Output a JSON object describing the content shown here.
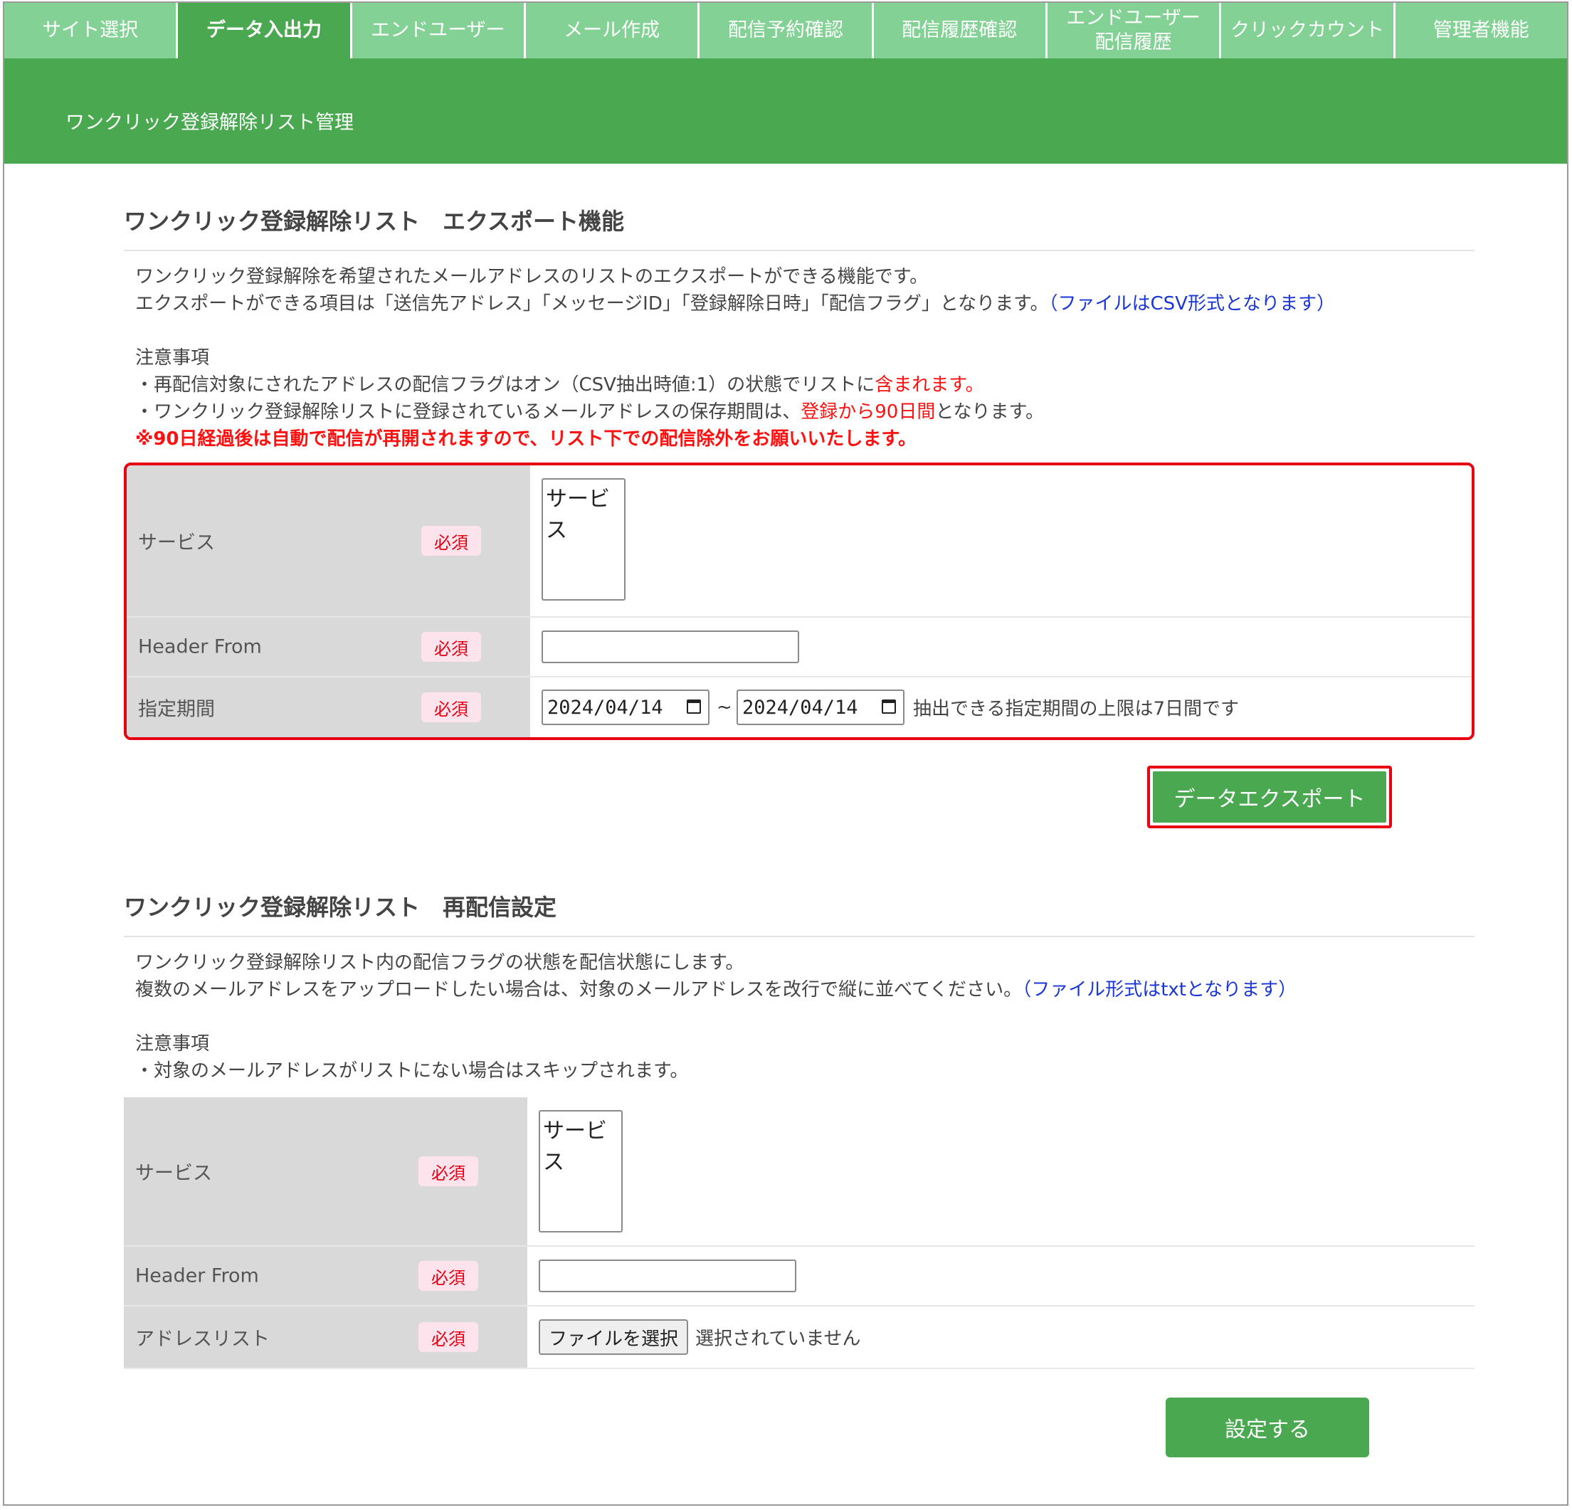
{
  "nav": {
    "tabs": [
      {
        "label": "サイト選択"
      },
      {
        "label": "データ入出力"
      },
      {
        "label": "エンドユーザー"
      },
      {
        "label": "メール作成"
      },
      {
        "label": "配信予約確認"
      },
      {
        "label": "配信履歴確認"
      },
      {
        "label": "エンドユーザー\n配信履歴"
      },
      {
        "label": "クリックカウント"
      },
      {
        "label": "管理者機能"
      }
    ]
  },
  "header": {
    "title": "ワンクリック登録解除リスト管理"
  },
  "export_section": {
    "title": "ワンクリック登録解除リスト　エクスポート機能",
    "desc1": "ワンクリック登録解除を希望されたメールアドレスのリストのエクスポートができる機能です。",
    "desc2": "エクスポートができる項目は「送信先アドレス」「メッセージID」「登録解除日時」「配信フラグ」となります。",
    "desc2_note": "（ファイルはCSV形式となります）",
    "notes_heading": "注意事項",
    "note1": "・再配信対象にされたアドレスの配信フラグはオン（CSV抽出時値:1）の状態でリストに",
    "note1_red": "含まれます。",
    "note2": "・ワンクリック登録解除リストに登録されているメールアドレスの保存期間は、",
    "note2_red": "登録から90日間",
    "note2_end": "となります。",
    "warning_a": "※90日経過後は自動で配信が再開されますので、",
    "warning_b": "リスト下での配信除外をお願いいたします。",
    "service_label": "サービス",
    "service_option": "サービス",
    "header_from_label": "Header From",
    "period_label": "指定期間",
    "required": "必須",
    "date_from": "2024/04/14",
    "date_to": "2024/04/14",
    "tilde": "~",
    "period_hint": "抽出できる指定期間の上限は7日間です",
    "button": "データエクスポート"
  },
  "resend_section": {
    "title": "ワンクリック登録解除リスト　再配信設定",
    "desc1": "ワンクリック登録解除リスト内の配信フラグの状態を配信状態にします。",
    "desc2": "複数のメールアドレスをアップロードしたい場合は、対象のメールアドレスを改行で縦に並べてください。",
    "desc2_note": "（ファイル形式はtxtとなります）",
    "notes_heading": "注意事項",
    "note1": "・対象のメールアドレスがリストにない場合はスキップされます。",
    "service_label": "サービス",
    "service_option": "サービス",
    "header_from_label": "Header From",
    "address_list_label": "アドレスリスト",
    "required": "必須",
    "file_button": "ファイルを選択",
    "file_status": "選択されていません",
    "button": "設定する"
  },
  "colors": {
    "tab": "#84d195",
    "tab_active": "#4aa851",
    "header": "#4aa851",
    "highlight": "#e60012",
    "link": "#1a36d6",
    "warning": "#ff1010"
  },
  "icons": [
    "calendar-icon"
  ]
}
